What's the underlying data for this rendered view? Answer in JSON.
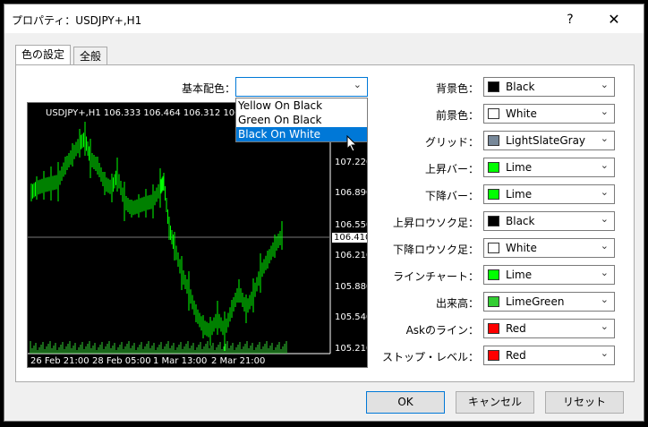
{
  "dialog": {
    "title": "プロパティ：USDJPY+,H1",
    "help": "?",
    "close": "✕"
  },
  "tabs": [
    {
      "label": "色の設定",
      "active": true
    },
    {
      "label": "全般",
      "active": false
    }
  ],
  "scheme": {
    "label": "基本配色：",
    "value": "",
    "options": [
      "Yellow On Black",
      "Green On Black",
      "Black On White"
    ],
    "highlighted": "Black On White"
  },
  "preview": {
    "header": "USDJPY+,H1  106.333 106.464 106.312 106.41",
    "price_levels": [
      "107.220",
      "106.890",
      "106.550",
      "106.410",
      "106.210",
      "105.880",
      "105.540",
      "105.210"
    ],
    "current_price": "106.410",
    "time_labels": [
      "26 Feb 21:00",
      "28 Feb 05:00",
      "1 Mar 13:00",
      "2 Mar 21:00"
    ]
  },
  "colors": [
    {
      "label": "背景色：",
      "value": "Black",
      "hex": "#000000"
    },
    {
      "label": "前景色：",
      "value": "White",
      "hex": "#ffffff"
    },
    {
      "label": "グリッド：",
      "value": "LightSlateGray",
      "hex": "#778899"
    },
    {
      "label": "上昇バー：",
      "value": "Lime",
      "hex": "#00ff00"
    },
    {
      "label": "下降バー：",
      "value": "Lime",
      "hex": "#00ff00"
    },
    {
      "label": "上昇ロウソク足：",
      "value": "Black",
      "hex": "#000000"
    },
    {
      "label": "下降ロウソク足：",
      "value": "White",
      "hex": "#ffffff"
    },
    {
      "label": "ラインチャート：",
      "value": "Lime",
      "hex": "#00ff00"
    },
    {
      "label": "出来高：",
      "value": "LimeGreen",
      "hex": "#32cd32"
    },
    {
      "label": "Askのライン：",
      "value": "Red",
      "hex": "#ff0000"
    },
    {
      "label": "ストップ・レベル：",
      "value": "Red",
      "hex": "#ff0000"
    }
  ],
  "buttons": {
    "ok": "OK",
    "cancel": "キャンセル",
    "reset": "リセット"
  },
  "icons": {
    "dropdown_arrow": "chevron-down-icon",
    "help": "help-icon",
    "close": "close-icon",
    "cursor": "mouse-cursor-icon"
  }
}
